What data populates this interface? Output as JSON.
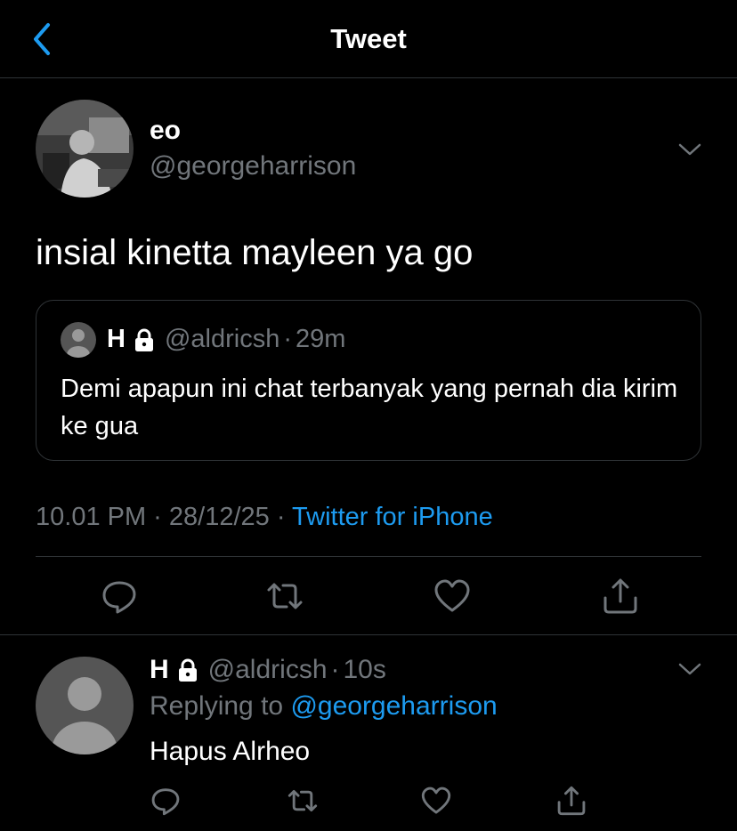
{
  "header": {
    "title": "Tweet"
  },
  "tweet": {
    "author_name": "eo",
    "author_handle": "@georgeharrison",
    "text": "insial kinetta mayleen ya go",
    "quote": {
      "name": "H",
      "handle": "@aldricsh",
      "separator": "·",
      "time": "29m",
      "text": "Demi apapun ini chat terbanyak yang pernah dia kirim ke gua"
    },
    "timestamp": "10.01 PM · 28/12/25 ·",
    "source": "Twitter for iPhone"
  },
  "reply": {
    "name": "H",
    "handle": "@aldricsh",
    "separator": "·",
    "time": "10s",
    "replying_prefix": "Replying to",
    "replying_to": "@georgeharrison",
    "text": "Hapus Alrheo"
  },
  "colors": {
    "background": "#000000",
    "text": "#ffffff",
    "muted": "#71767b",
    "accent": "#1d9bf0",
    "border": "#2f3336"
  },
  "icons": [
    "back-chevron-icon",
    "chevron-down-icon",
    "lock-icon",
    "reply-icon",
    "retweet-icon",
    "like-icon",
    "share-icon"
  ]
}
